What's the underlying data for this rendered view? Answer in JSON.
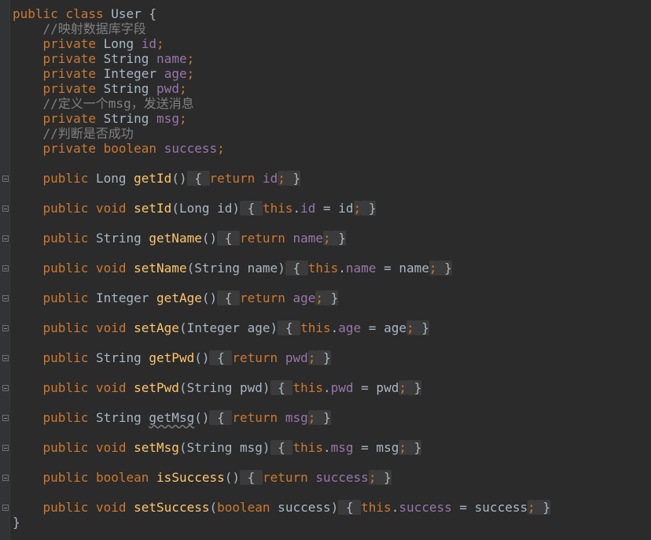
{
  "code": {
    "class_header": {
      "kw_public": "public",
      "kw_class": "class",
      "name": "User",
      "brace": " {"
    },
    "closing_brace": "}",
    "comments": [
      "//映射数据库字段",
      "//定义一个msg，发送消息",
      "//判断是否成功"
    ],
    "fields": [
      {
        "mod": "private",
        "type": "Long",
        "name": "id",
        "semi": ";"
      },
      {
        "mod": "private",
        "type": "String",
        "name": "name",
        "semi": ";"
      },
      {
        "mod": "private",
        "type": "Integer",
        "name": "age",
        "semi": ";"
      },
      {
        "mod": "private",
        "type": "String",
        "name": "pwd",
        "semi": ";"
      },
      {
        "mod": "private",
        "type": "String",
        "name": "msg",
        "semi": ";"
      },
      {
        "mod": "private",
        "type": "boolean",
        "name": "success",
        "semi": ";"
      }
    ],
    "methods": [
      {
        "mod": "public",
        "ret": "Long",
        "name": "getId",
        "params_open": "(",
        "param_type": "",
        "param_name": "",
        "params_close": ")",
        "open": " { ",
        "body_kw": "return",
        "body_field": "id",
        "body_rest": "",
        "semi": ";",
        "close": " }"
      },
      {
        "mod": "public",
        "ret": "void",
        "name": "setId",
        "params_open": "(",
        "param_type": "Long",
        "param_name": " id",
        "params_close": ")",
        "open": " { ",
        "body_kw": "this",
        "body_field": "id",
        "body_rest": " = id",
        "semi": ";",
        "close": " }"
      },
      {
        "mod": "public",
        "ret": "String",
        "name": "getName",
        "params_open": "(",
        "param_type": "",
        "param_name": "",
        "params_close": ")",
        "open": " { ",
        "body_kw": "return",
        "body_field": "name",
        "body_rest": "",
        "semi": ";",
        "close": " }"
      },
      {
        "mod": "public",
        "ret": "void",
        "name": "setName",
        "params_open": "(",
        "param_type": "String",
        "param_name": " name",
        "params_close": ")",
        "open": " { ",
        "body_kw": "this",
        "body_field": "name",
        "body_rest": " = name",
        "semi": ";",
        "close": " }"
      },
      {
        "mod": "public",
        "ret": "Integer",
        "name": "getAge",
        "params_open": "(",
        "param_type": "",
        "param_name": "",
        "params_close": ")",
        "open": " { ",
        "body_kw": "return",
        "body_field": "age",
        "body_rest": "",
        "semi": ";",
        "close": " }"
      },
      {
        "mod": "public",
        "ret": "void",
        "name": "setAge",
        "params_open": "(",
        "param_type": "Integer",
        "param_name": " age",
        "params_close": ")",
        "open": " { ",
        "body_kw": "this",
        "body_field": "age",
        "body_rest": " = age",
        "semi": ";",
        "close": " }"
      },
      {
        "mod": "public",
        "ret": "String",
        "name": "getPwd",
        "params_open": "(",
        "param_type": "",
        "param_name": "",
        "params_close": ")",
        "open": " { ",
        "body_kw": "return",
        "body_field": "pwd",
        "body_rest": "",
        "semi": ";",
        "close": " }"
      },
      {
        "mod": "public",
        "ret": "void",
        "name": "setPwd",
        "params_open": "(",
        "param_type": "String",
        "param_name": " pwd",
        "params_close": ")",
        "open": " { ",
        "body_kw": "this",
        "body_field": "pwd",
        "body_rest": " = pwd",
        "semi": ";",
        "close": " }"
      },
      {
        "mod": "public",
        "ret": "String",
        "name": "getMsg",
        "params_open": "(",
        "param_type": "",
        "param_name": "",
        "params_close": ")",
        "open": " { ",
        "body_kw": "return",
        "body_field": "msg",
        "body_rest": "",
        "semi": ";",
        "close": " }",
        "unused": true
      },
      {
        "mod": "public",
        "ret": "void",
        "name": "setMsg",
        "params_open": "(",
        "param_type": "String",
        "param_name": " msg",
        "params_close": ")",
        "open": " { ",
        "body_kw": "this",
        "body_field": "msg",
        "body_rest": " = msg",
        "semi": ";",
        "close": " }"
      },
      {
        "mod": "public",
        "ret": "boolean",
        "name": "isSuccess",
        "params_open": "(",
        "param_type": "",
        "param_name": "",
        "params_close": ")",
        "open": " { ",
        "body_kw": "return",
        "body_field": "success",
        "body_rest": "",
        "semi": ";",
        "close": " }"
      },
      {
        "mod": "public",
        "ret": "void",
        "name": "setSuccess",
        "params_open": "(",
        "param_type": "boolean",
        "param_name": " success",
        "params_close": ")",
        "open": " { ",
        "body_kw": "this",
        "body_field": "success",
        "body_rest": " = success",
        "semi": ";",
        "close": " }"
      }
    ]
  },
  "colors": {
    "background": "#2b2b2b",
    "keyword": "#cc7832",
    "field": "#9876aa",
    "method": "#ffc66d",
    "comment": "#808080",
    "text": "#a9b7c6"
  }
}
